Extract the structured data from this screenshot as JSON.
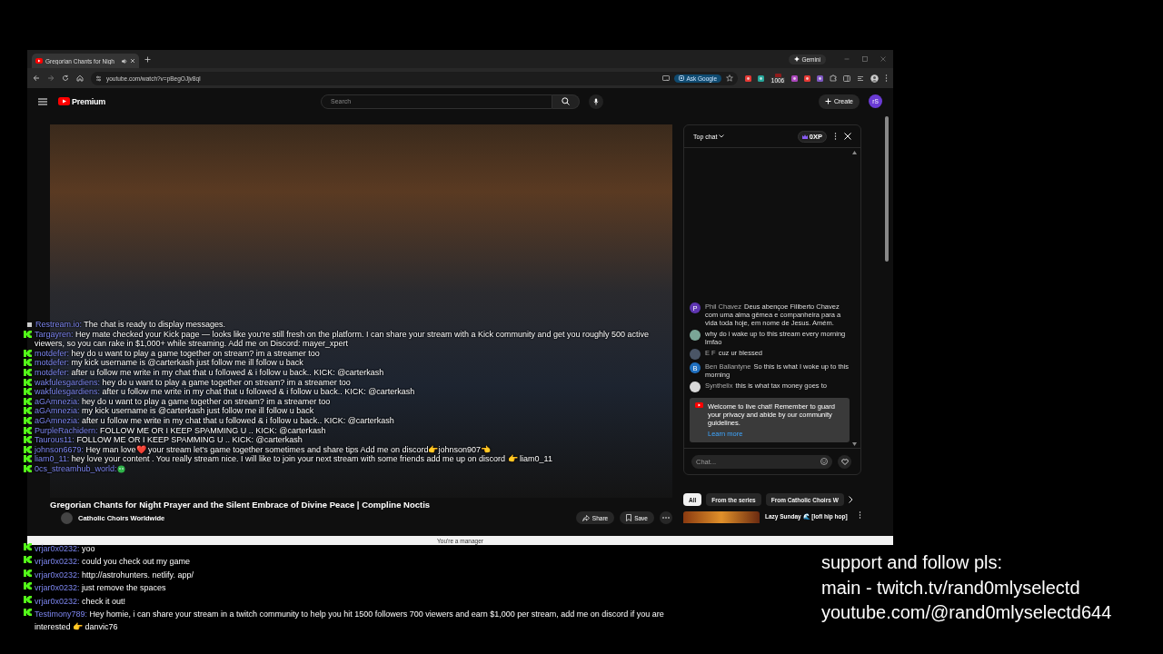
{
  "browser": {
    "tab": {
      "title": "Gregorian Chants for Nigh",
      "audio": true
    },
    "gemini": "Gemini",
    "url": "youtube.com/watch?v=pBegOJjv8qI",
    "ask_google": "Ask Google",
    "extension_badge": "1006"
  },
  "youtube": {
    "logo": "Premium",
    "search": {
      "placeholder": "Search"
    },
    "create": "Create",
    "avatar": "rS",
    "video": {
      "title": "Gregorian Chants for Night Prayer and the Silent Embrace of Divine Peace | Compline Noctis",
      "channel": "Catholic Choirs Worldwide",
      "actions": [
        "Share",
        "Save"
      ]
    },
    "live_chat": {
      "title": "Top chat",
      "xp": "0XP",
      "messages": [
        {
          "author": "Phil Chavez",
          "text": "Deus abençoe Filiberto Chavez com uma alma gêmea e companheira para a vida toda hoje, em nome de Jesus. Amém.",
          "avatar_letter": "P",
          "color": "#5e35b1"
        },
        {
          "text": "why do i wake up to this stream every morning lmfao",
          "color": "#7aa596"
        },
        {
          "author": "E F",
          "text": "cuz ur blessed",
          "color": "#4a5566"
        },
        {
          "author": "Ben Ballantyne",
          "text": "So this is what I woke up to this morning",
          "avatar_letter": "B",
          "color": "#1f6fbf"
        },
        {
          "author": "Synthelix",
          "text": "this is what tax money goes to",
          "color": "#d8d8d8"
        }
      ],
      "welcome": {
        "text": "Welcome to live chat! Remember to guard your privacy and abide by our community guidelines.",
        "link": "Learn more"
      },
      "input": {
        "placeholder": "Chat..."
      }
    },
    "chips": [
      {
        "label": "All",
        "selected": true
      },
      {
        "label": "From the series",
        "selected": false
      },
      {
        "label": "From Catholic Choirs W",
        "selected": false
      }
    ],
    "recommended": [
      {
        "title": "Lazy Sunday 🌊 [lofi hip hop]"
      }
    ],
    "banner": "You're a manager"
  },
  "stream_chat": {
    "upper": [
      {
        "kind": "restream",
        "user": "Restream.io:",
        "text": "The chat is ready to display messages."
      },
      {
        "kind": "kick",
        "user": "Targayren:",
        "text": "Hey mate checked your Kick page — looks like you're still fresh on the platform. I can share your stream with a Kick community and get you roughly 500 active viewers, so you can rake in $1,000+ while streaming. Add me on Discord: mayer_xpert"
      },
      {
        "kind": "kick",
        "user": "motdefer:",
        "text": "hey do u want to play a game together on stream? im a streamer too"
      },
      {
        "kind": "kick",
        "user": "motdefer:",
        "text": "my kick username is @carterkash just follow me ill follow u back"
      },
      {
        "kind": "kick",
        "user": "motdefer:",
        "text": "after u follow me write in my chat that u followed & i follow u back.. KICK: @carterkash"
      },
      {
        "kind": "kick",
        "user": "wakfulesgardiens:",
        "text": "hey do u want to play a game together on stream? im a streamer too"
      },
      {
        "kind": "kick",
        "user": "wakfulesgardiens:",
        "text": "after u follow me write in my chat that u followed & i follow u back.. KICK: @carterkash"
      },
      {
        "kind": "kick",
        "user": "aGAmnezia:",
        "text": "hey do u want to play a game together on stream? im a streamer too"
      },
      {
        "kind": "kick",
        "user": "aGAmnezia:",
        "text": "my kick username is @carterkash just follow me ill follow u back"
      },
      {
        "kind": "kick",
        "user": "aGAmnezia:",
        "text": "after u follow me write in my chat that u followed & i follow u back.. KICK: @carterkash"
      },
      {
        "kind": "kick",
        "user": "PurpleRachidern:",
        "text": "FOLLOW ME OR I KEEP SPAMMING U .. KICK: @carterkash"
      },
      {
        "kind": "kick",
        "user": "Taurous11:",
        "text": "FOLLOW ME OR I KEEP SPAMMING U .. KICK: @carterkash"
      },
      {
        "kind": "kick",
        "user": "johnson6679:",
        "text": "Hey man love❤️ your stream let's game together sometimes and share tips Add me on discord👉johnson907👈"
      },
      {
        "kind": "kick",
        "user": "liam0_11:",
        "text": "hey love your content . You really stream nice. I will like to join your next stream with some friends add me up on discord 👉 liam0_11"
      },
      {
        "kind": "kick",
        "user": "0cs_streamhub_world:"
      }
    ],
    "lower": [
      {
        "kind": "kick",
        "user": "vrjar0x0232:",
        "text": "yoo"
      },
      {
        "kind": "kick",
        "user": "vrjar0x0232:",
        "text": "could you check out my game"
      },
      {
        "kind": "kick",
        "user": "vrjar0x0232:",
        "text": "http://astrohunters. netlify. app/"
      },
      {
        "kind": "kick",
        "user": "vrjar0x0232:",
        "text": "just remove the spaces"
      },
      {
        "kind": "kick",
        "user": "vrjar0x0232:",
        "text": "check it out!"
      },
      {
        "kind": "kick",
        "user": "Testimony789:",
        "text": "Hey homie, i can share your stream in a twitch community to help you hit 1500 followers 700 viewers and earn $1,000 per stream, add me on discord if you are interested 👉 danvic76"
      }
    ]
  },
  "support_text": [
    "support and follow pls:",
    "main - twitch.tv/rand0mlyselectd",
    "youtube.com/@rand0mlyselectd644"
  ]
}
